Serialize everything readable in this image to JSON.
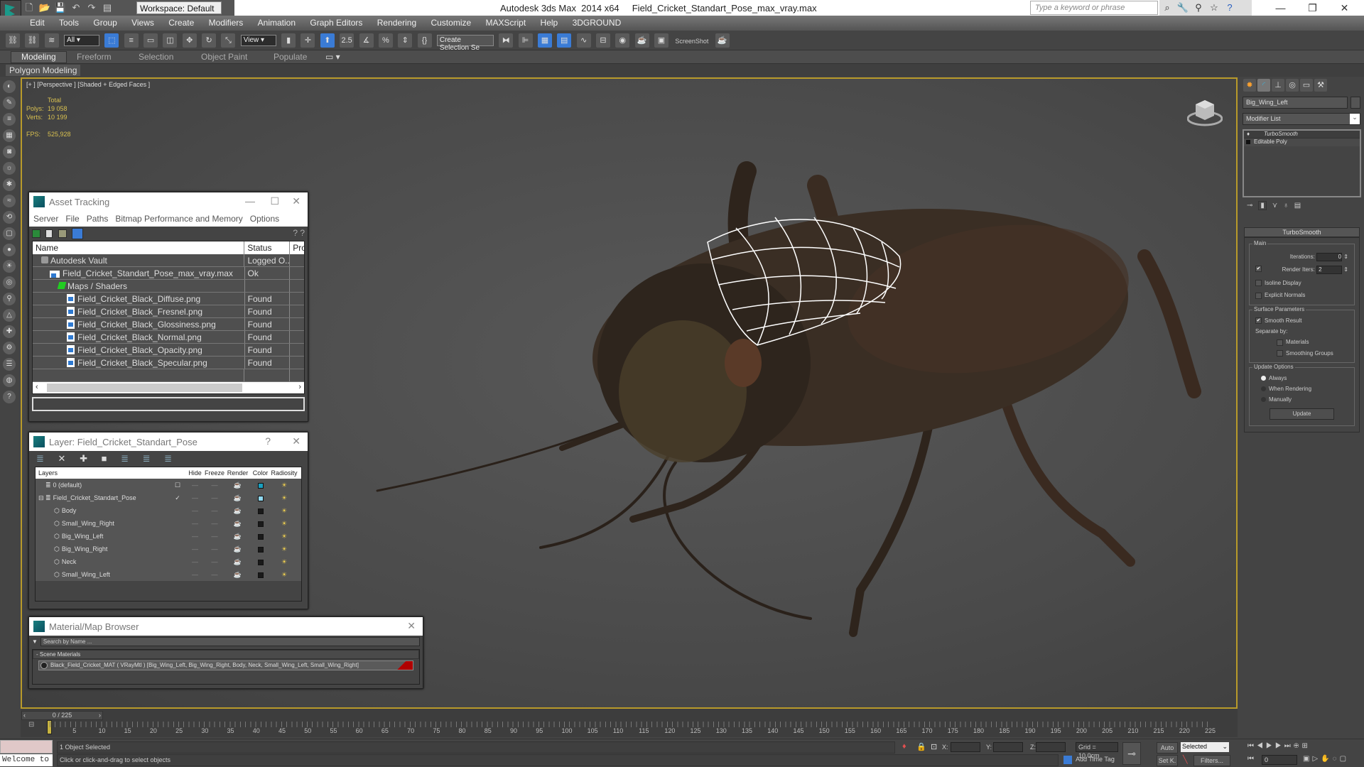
{
  "titlebar": {
    "app_title": "Autodesk 3ds Max  2014 x64",
    "file_title": "Field_Cricket_Standart_Pose_max_vray.max",
    "workspace": "Workspace: Default",
    "search_placeholder": "Type a keyword or phrase",
    "window_controls": {
      "minimize": "—",
      "maximize": "❐",
      "close": "✕"
    }
  },
  "menubar": [
    "Edit",
    "Tools",
    "Group",
    "Views",
    "Create",
    "Modifiers",
    "Animation",
    "Graph Editors",
    "Rendering",
    "Customize",
    "MAXScript",
    "Help",
    "3DGROUND"
  ],
  "toolbar": {
    "selection_filter": "All",
    "ref_coord": "View",
    "named_selection_placeholder": "Create Selection Se",
    "screenshot_label": "ScreenShot"
  },
  "ribbon": {
    "tabs": [
      "Modeling",
      "Freeform",
      "Selection",
      "Object Paint",
      "Populate"
    ],
    "active_tab": "Modeling",
    "panel_label": "Polygon Modeling"
  },
  "viewport": {
    "label": "[+ ] [Perspective ] [Shaded + Edged Faces ]",
    "stats": {
      "header": "Total",
      "polys_label": "Polys:",
      "polys": "19 058",
      "verts_label": "Verts:",
      "verts": "10 199",
      "fps_label": "FPS:",
      "fps": "525,928"
    }
  },
  "asset_tracking": {
    "title": "Asset Tracking",
    "menu": [
      "Server",
      "File",
      "Paths",
      "Bitmap Performance and Memory",
      "Options"
    ],
    "columns": [
      "Name",
      "Status",
      "Pro"
    ],
    "rows": [
      {
        "name": "Autodesk Vault",
        "status": "Logged O...",
        "indent": 1,
        "icon": "vault"
      },
      {
        "name": "Field_Cricket_Standart_Pose_max_vray.max",
        "status": "Ok",
        "indent": 2,
        "icon": "max-file"
      },
      {
        "name": "Maps / Shaders",
        "status": "",
        "indent": 3,
        "icon": "maps"
      },
      {
        "name": "Field_Cricket_Black_Diffuse.png",
        "status": "Found",
        "indent": 4,
        "icon": "image"
      },
      {
        "name": "Field_Cricket_Black_Fresnel.png",
        "status": "Found",
        "indent": 4,
        "icon": "image"
      },
      {
        "name": "Field_Cricket_Black_Glossiness.png",
        "status": "Found",
        "indent": 4,
        "icon": "image"
      },
      {
        "name": "Field_Cricket_Black_Normal.png",
        "status": "Found",
        "indent": 4,
        "icon": "image"
      },
      {
        "name": "Field_Cricket_Black_Opacity.png",
        "status": "Found",
        "indent": 4,
        "icon": "image"
      },
      {
        "name": "Field_Cricket_Black_Specular.png",
        "status": "Found",
        "indent": 4,
        "icon": "image"
      }
    ]
  },
  "layer_dialog": {
    "title": "Layer: Field_Cricket_Standart_Pose",
    "help": "?",
    "columns": [
      "Layers",
      "",
      "Hide",
      "Freeze",
      "Render",
      "Color",
      "Radiosity"
    ],
    "rows": [
      {
        "name": "0 (default)",
        "active": "☐",
        "color": "#1aa0c0",
        "indent": 1
      },
      {
        "name": "Field_Cricket_Standart_Pose",
        "active": "✓",
        "color": "#8fd8f0",
        "indent": 1
      },
      {
        "name": "Body",
        "active": "",
        "color": "#1a1a1a",
        "indent": 2
      },
      {
        "name": "Small_Wing_Right",
        "active": "",
        "color": "#1a1a1a",
        "indent": 2
      },
      {
        "name": "Big_Wing_Left",
        "active": "",
        "color": "#1a1a1a",
        "indent": 2
      },
      {
        "name": "Big_Wing_Right",
        "active": "",
        "color": "#1a1a1a",
        "indent": 2
      },
      {
        "name": "Neck",
        "active": "",
        "color": "#1a1a1a",
        "indent": 2
      },
      {
        "name": "Small_Wing_Left",
        "active": "",
        "color": "#1a1a1a",
        "indent": 2
      }
    ]
  },
  "material_browser": {
    "title": "Material/Map Browser",
    "search_placeholder": "Search by Name ...",
    "group": "- Scene Materials",
    "material": "Black_Field_Cricket_MAT ( VRayMtl ) [Big_Wing_Left, Big_Wing_Right, Body, Neck, Small_Wing_Left, Small_Wing_Right]"
  },
  "command_panel": {
    "object_name": "Big_Wing_Left",
    "modifier_list": "Modifier List",
    "stack": [
      "TurboSmooth",
      "Editable Poly"
    ],
    "turbosmooth": {
      "title": "TurboSmooth",
      "main": "Main",
      "iterations_label": "Iterations:",
      "iterations": "0",
      "render_iters_label": "Render Iters:",
      "render_iters": "2",
      "render_iters_checked": true,
      "isoline_display": "Isoline Display",
      "explicit_normals": "Explicit Normals",
      "surface_params": "Surface Parameters",
      "smooth_result": "Smooth Result",
      "separate_by": "Separate by:",
      "materials": "Materials",
      "smoothing_groups": "Smoothing Groups",
      "update_options": "Update Options",
      "always": "Always",
      "when_rendering": "When Rendering",
      "manually": "Manually",
      "update_button": "Update"
    }
  },
  "timeline": {
    "slider": "0 / 225",
    "current_frame": 0,
    "total_frames": 225,
    "ticks": [
      0,
      5,
      10,
      15,
      20,
      25,
      30,
      35,
      40,
      45,
      50,
      55,
      60,
      65,
      70,
      75,
      80,
      85,
      90,
      95,
      100,
      105,
      110,
      115,
      120,
      125,
      130,
      135,
      140,
      145,
      150,
      155,
      160,
      165,
      170,
      175,
      180,
      185,
      190,
      195,
      200,
      205,
      210,
      215,
      220,
      225
    ]
  },
  "status": {
    "listener_text": "Welcome to",
    "selection": "1 Object Selected",
    "prompt": "Click or click-and-drag to select objects",
    "x_label": "X:",
    "y_label": "Y:",
    "z_label": "Z:",
    "grid": "Grid = 10,0cm",
    "add_time_tag": "Add Time Tag",
    "auto": "Auto",
    "set_key": "Set K.",
    "key_filter": "Selected",
    "filters": "Filters...",
    "frame": "0"
  }
}
